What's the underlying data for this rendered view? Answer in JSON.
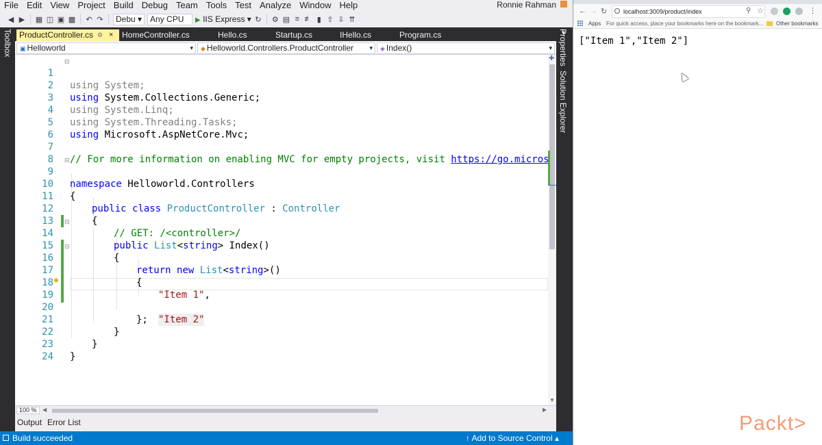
{
  "menu": {
    "items": [
      "File",
      "Edit",
      "View",
      "Project",
      "Build",
      "Debug",
      "Team",
      "Tools",
      "Test",
      "Analyze",
      "Window",
      "Help"
    ],
    "user": "Ronnie Rahman"
  },
  "toolbar": {
    "config": "Debu ▾",
    "platform": "Any CPU",
    "run_target": "IIS Express ▾"
  },
  "side": {
    "toolbox": "Toolbox",
    "properties": "Properties",
    "solution_explorer": "Solution Explorer"
  },
  "tabs": [
    {
      "label": "ProductController.cs",
      "active": true
    },
    {
      "label": "HomeController.cs",
      "active": false
    },
    {
      "label": "Hello.cs",
      "active": false
    },
    {
      "label": "Startup.cs",
      "active": false
    },
    {
      "label": "IHello.cs",
      "active": false
    },
    {
      "label": "Program.cs",
      "active": false
    }
  ],
  "navbar": {
    "project": "Helloworld",
    "class": "Helloworld.Controllers.ProductController",
    "member": "Index()"
  },
  "code": {
    "line_numbers": [
      "1",
      "2",
      "3",
      "4",
      "5",
      "6",
      "7",
      "8",
      "9",
      "10",
      "11",
      "12",
      "13",
      "14",
      "15",
      "16",
      "17",
      "18",
      "19",
      "20",
      "21",
      "22",
      "23",
      "24"
    ],
    "l1": "using System;",
    "l2": "System.Collections.Generic;",
    "l3": "using System.Linq;",
    "l4": "using System.Threading.Tasks;",
    "l5": "Microsoft.AspNetCore.Mvc;",
    "l7": "// For more information on enabling MVC for empty projects, visit ",
    "l7_url": "https://go.microsoft",
    "l9": "Helloworld.Controllers",
    "l11_class": "ProductController",
    "l11_base": "Controller",
    "l13": "// GET: /<controller>/",
    "l14_name": " Index()",
    "l16_type": "List",
    "l16_tail": "()",
    "l18": "\"Item 1\"",
    "l19": "\"Item 2\"",
    "kw_using": "using",
    "kw_namespace": "namespace",
    "kw_public": "public",
    "kw_class": "class",
    "kw_return": "return",
    "kw_new": "new",
    "kw_string": "string",
    "ty_list": "List",
    "open_brace": "{",
    "close_brace": "}",
    "close_stmt": "};",
    "colon": " : ",
    "comma": ","
  },
  "editor_status": {
    "zoom": "100 %"
  },
  "panel_tabs": [
    "Output",
    "Error List"
  ],
  "status": {
    "message": "Build succeeded",
    "source_control": "↑ Add to Source Control ▴"
  },
  "browser": {
    "url": "localhost:3009/product/index",
    "bookmarks_apps": "Apps",
    "bookmarks_hint": "For quick access, place your bookmarks here on the bookmark...",
    "other_bookmarks": "Other bookmarks",
    "json_output": "[\"Item 1\",\"Item 2\"]"
  },
  "watermark": "Packt>",
  "colors": {
    "status_bar": "#007acc",
    "active_tab": "#fff29d",
    "keyword": "#0000ff",
    "type": "#2b91af",
    "comment": "#008000",
    "string": "#a31515"
  }
}
